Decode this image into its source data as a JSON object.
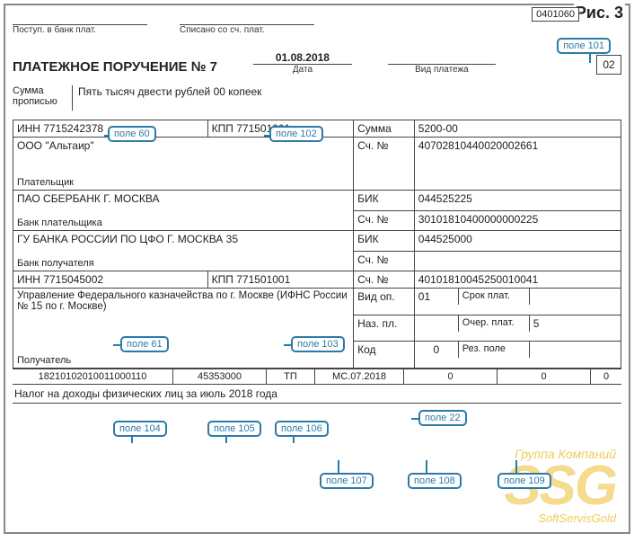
{
  "figure_label": "Рис. 3",
  "form_code": "0401060",
  "header": {
    "received_label": "Поступ. в банк плат.",
    "debited_label": "Списано со сч. плат."
  },
  "title": {
    "doc_name": "ПЛАТЕЖНОЕ ПОРУЧЕНИЕ № 7",
    "date": "01.08.2018",
    "date_label": "Дата",
    "vid_label": "Вид платежа",
    "box_val": "02"
  },
  "sum_words": {
    "label": "Сумма прописью",
    "value": "Пять тысяч двести рублей 00 копеек"
  },
  "payer": {
    "inn_label": "ИНН",
    "inn": "7715242378",
    "kpp_label": "КПП",
    "kpp": "771501001",
    "name": "ООО \"Альтаир\"",
    "caption": "Плательщик",
    "sum_label": "Сумма",
    "sum": "5200-00",
    "acc_label": "Сч. №",
    "acc": "40702810440020002661"
  },
  "payer_bank": {
    "name": "ПАО СБЕРБАНК Г. МОСКВА",
    "caption": "Банк плательщика",
    "bik_label": "БИК",
    "bik": "044525225",
    "acc_label": "Сч. №",
    "acc": "30101810400000000225"
  },
  "recip_bank": {
    "name": "ГУ БАНКА РОССИИ ПО ЦФО Г. МОСКВА 35",
    "caption": "Банк получателя",
    "bik_label": "БИК",
    "bik": "044525000",
    "acc_label": "Сч. №",
    "acc": ""
  },
  "recipient": {
    "inn_label": "ИНН",
    "inn": "7715045002",
    "kpp_label": "КПП",
    "kpp": "771501001",
    "name": "Управление Федерального казначейства по г. Москве (ИФНС России № 15 по г. Москве)",
    "caption": "Получатель",
    "acc_label": "Сч. №",
    "acc": "40101810045250010041",
    "vid_op_label": "Вид оп.",
    "vid_op": "01",
    "srok_label": "Срок плат.",
    "naz_pl_label": "Наз. пл.",
    "ocher_label": "Очер. плат.",
    "ocher": "5",
    "kod_label": "Код",
    "kod": "0",
    "rez_label": "Рез. поле"
  },
  "row104": {
    "c1": "18210102010011000110",
    "c2": "45353000",
    "c3": "ТП",
    "c4": "МС.07.2018",
    "c5": "0",
    "c6": "0",
    "c7": "0"
  },
  "purpose": "Налог на доходы физических лиц за июль 2018 года",
  "callouts": {
    "p101": "поле 101",
    "p60": "поле 60",
    "p102": "поле 102",
    "p61": "поле 61",
    "p103": "поле 103",
    "p22": "поле 22",
    "p104": "поле 104",
    "p105": "поле 105",
    "p106": "поле 106",
    "p107": "поле 107",
    "p108": "поле 108",
    "p109": "поле 109"
  },
  "watermark": {
    "top": "Группа Компаний",
    "big": "SSG",
    "bottom": "SoftServisGold"
  }
}
